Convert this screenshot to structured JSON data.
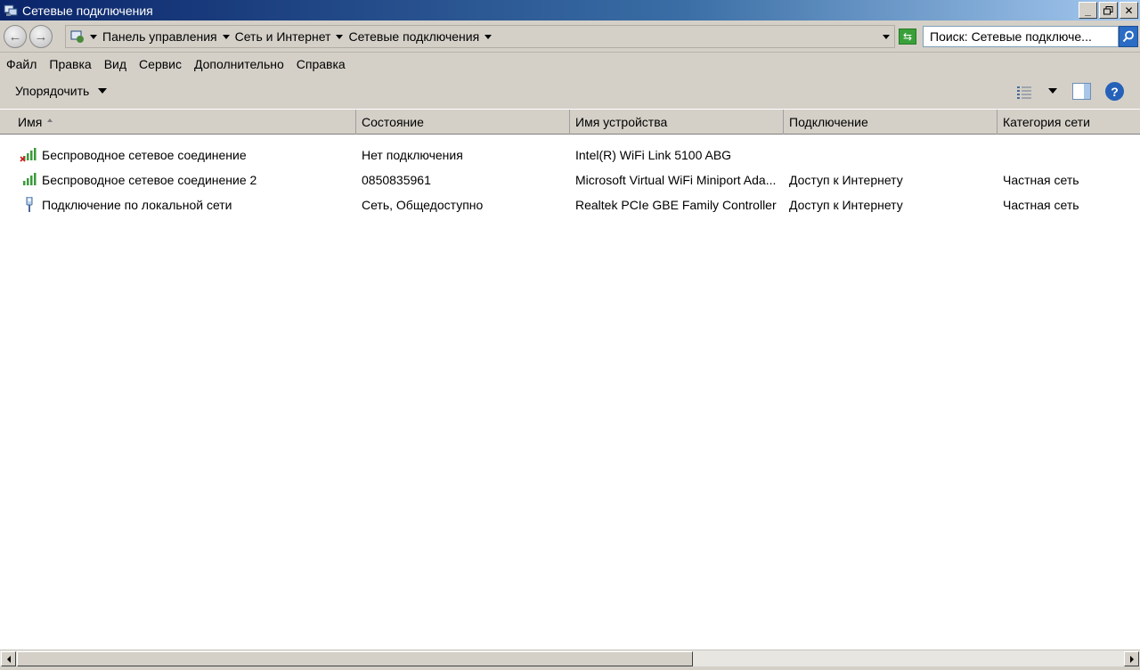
{
  "window": {
    "title": "Сетевые подключения"
  },
  "address": {
    "breadcrumbs": [
      "Панель управления",
      "Сеть и Интернет",
      "Сетевые подключения"
    ],
    "search_placeholder": "Поиск: Сетевые подключе..."
  },
  "menu": {
    "items": [
      "Файл",
      "Правка",
      "Вид",
      "Сервис",
      "Дополнительно",
      "Справка"
    ]
  },
  "toolbar": {
    "organize_label": "Упорядочить"
  },
  "columns": [
    "Имя",
    "Состояние",
    "Имя устройства",
    "Подключение",
    "Категория сети"
  ],
  "rows": [
    {
      "name": "Беспроводное сетевое соединение",
      "status": "Нет подключения",
      "device": "Intel(R) WiFi Link 5100 ABG",
      "connectivity": "",
      "category": "",
      "icon": "wireless-disconnected-icon"
    },
    {
      "name": "Беспроводное сетевое соединение 2",
      "status": "0850835961",
      "device": "Microsoft Virtual WiFi Miniport Ada...",
      "connectivity": "Доступ к Интернету",
      "category": "Частная сеть",
      "icon": "wireless-icon"
    },
    {
      "name": "Подключение по локальной сети",
      "status": "Сеть, Общедоступно",
      "device": "Realtek PCIe GBE Family Controller",
      "connectivity": "Доступ к Интернету",
      "category": "Частная сеть",
      "icon": "ethernet-icon"
    }
  ]
}
